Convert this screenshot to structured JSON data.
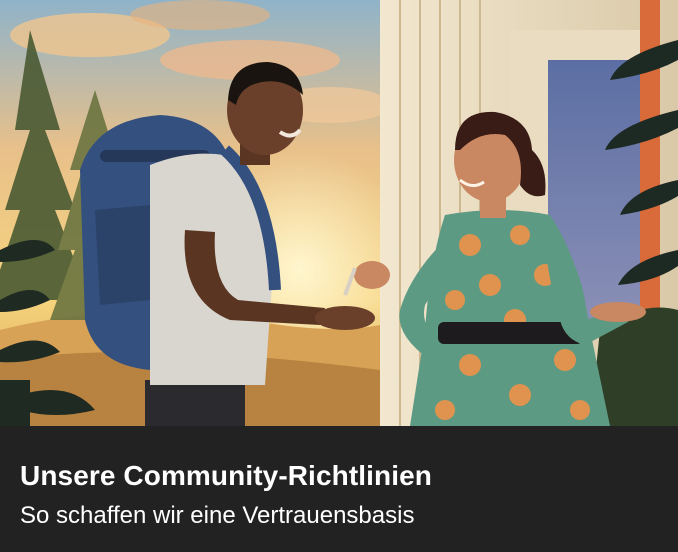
{
  "card": {
    "title": "Unsere Community-Richtlinien",
    "subtitle": "So schaffen wir eine Vertrauensbasis",
    "image_icon": "illustration-key-handover"
  },
  "colors": {
    "caption_background": "#222222",
    "text": "#ffffff"
  }
}
